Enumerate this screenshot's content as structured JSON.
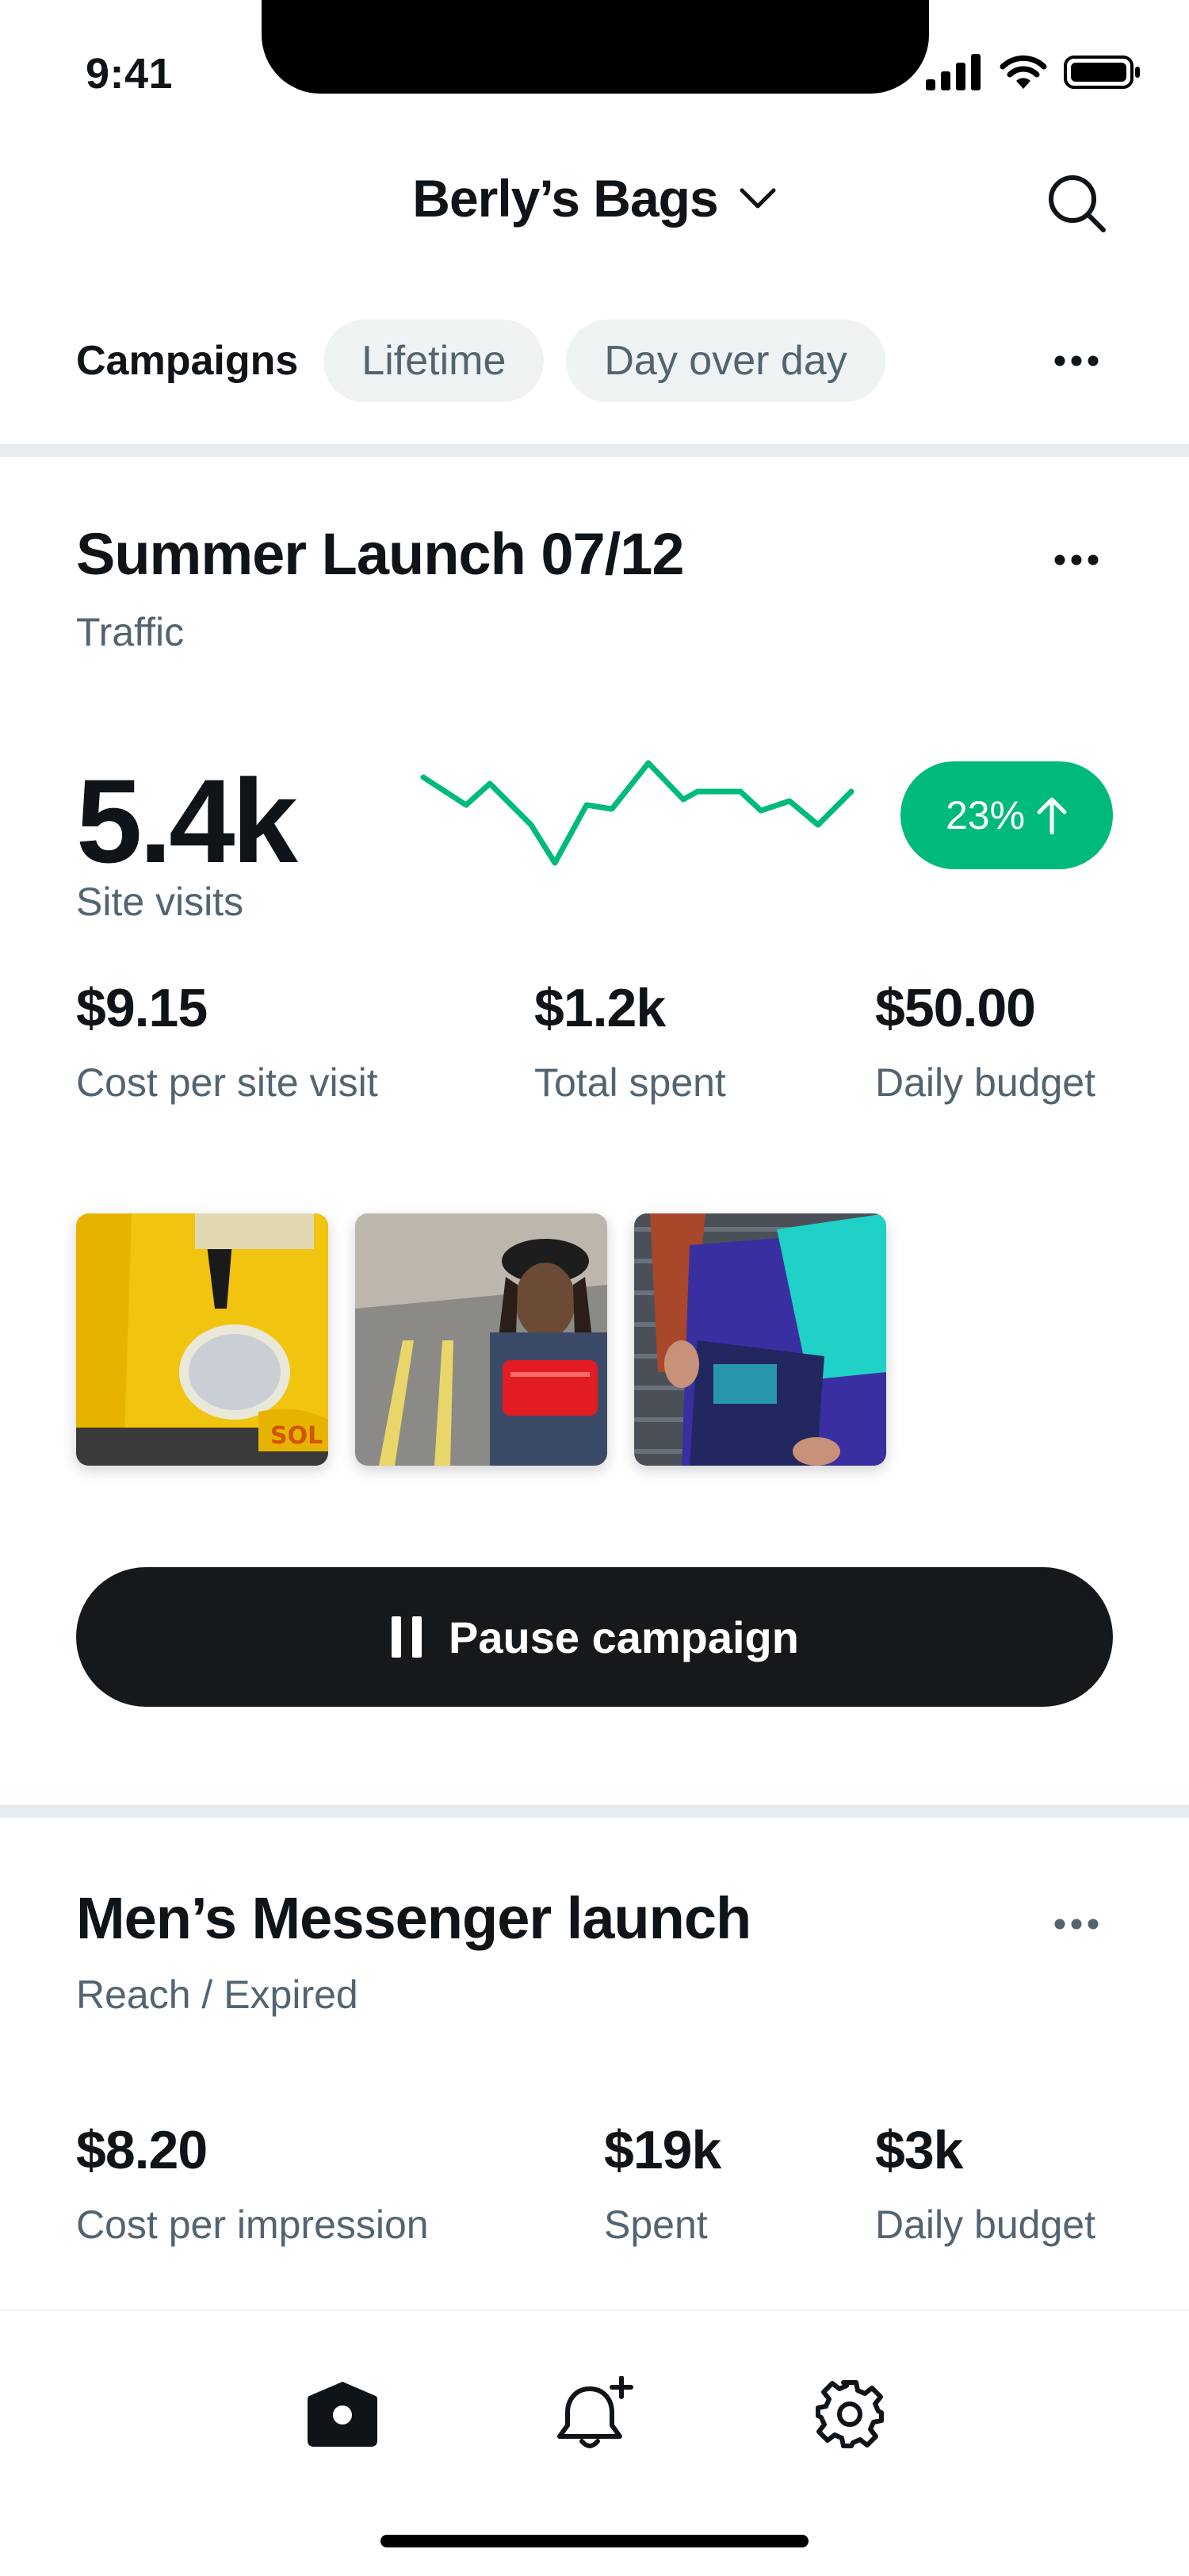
{
  "status_bar": {
    "time": "9:41"
  },
  "header": {
    "store_name": "Berly’s Bags"
  },
  "tabs": {
    "active": "Campaigns",
    "pills": [
      "Lifetime",
      "Day over day"
    ]
  },
  "campaigns": [
    {
      "title": "Summer Launch 07/12",
      "objective": "Traffic",
      "headline_metric": {
        "value": "5.4k",
        "label": "Site visits"
      },
      "change": "23%",
      "change_direction": "up",
      "stats": [
        {
          "value": "$9.15",
          "label": "Cost per site visit"
        },
        {
          "value": "$1.2k",
          "label": "Total spent"
        },
        {
          "value": "$50.00",
          "label": "Daily budget"
        }
      ],
      "creatives": [
        "yellow-hoodie-crossbody-bag",
        "red-chest-bag",
        "navy-teal-belt-bag"
      ],
      "action_label": "Pause campaign"
    },
    {
      "title": "Men’s Messenger launch",
      "objective": "Reach / Expired",
      "stats": [
        {
          "value": "$8.20",
          "label": "Cost per impression"
        },
        {
          "value": "$19k",
          "label": "Spent"
        },
        {
          "value": "$3k",
          "label": "Daily budget"
        }
      ]
    }
  ],
  "colors": {
    "accent_green": "#00ba7c",
    "dark_button": "#16191c",
    "muted_text": "#536471"
  },
  "bottom_nav": [
    "home-icon",
    "notification-add-icon",
    "settings-icon"
  ]
}
